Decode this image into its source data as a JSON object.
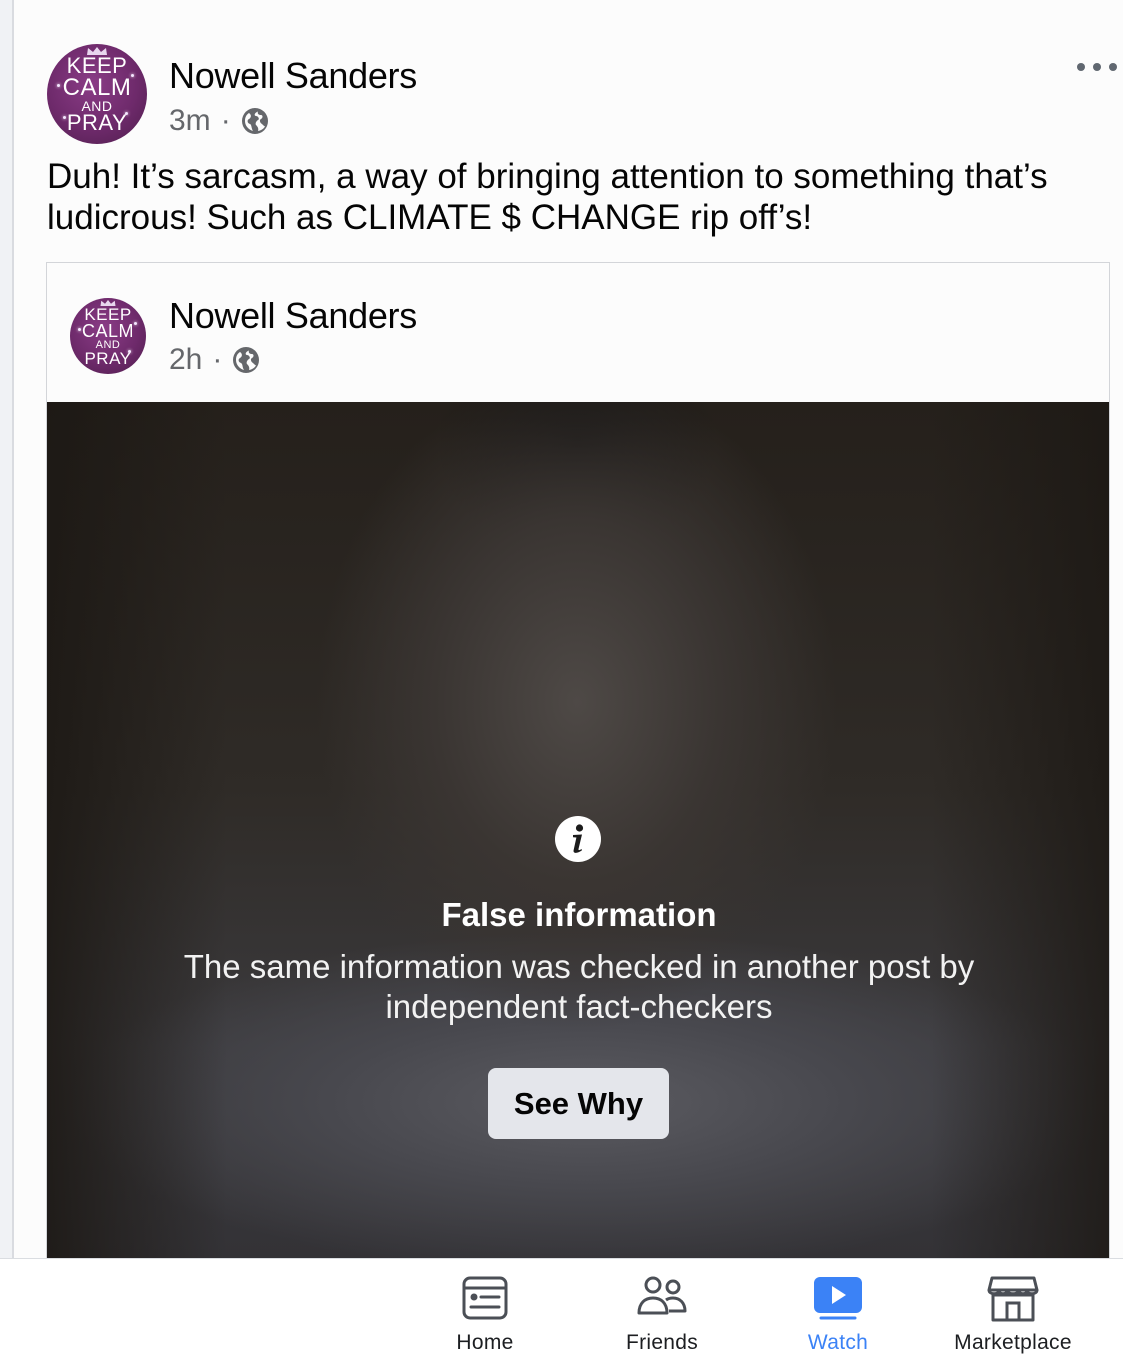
{
  "post": {
    "author": "Nowell Sanders",
    "time": "3m",
    "separator": "·",
    "text": "Duh! It’s sarcasm, a way of bringing attention to something that’s ludicrous! Such as CLIMATE $ CHANGE rip off’s!",
    "avatar_text": [
      "KEEP",
      "CALM",
      "AND",
      "PRAY"
    ]
  },
  "shared_post": {
    "author": "Nowell Sanders",
    "time": "2h",
    "separator": "·",
    "fact_check": {
      "title": "False information",
      "body": "The same information was checked in another post by independent fact-checkers",
      "button": "See Why"
    }
  },
  "tabbar": {
    "home": "Home",
    "friends": "Friends",
    "watch": "Watch",
    "marketplace": "Marketplace",
    "active": "watch"
  },
  "icons": {
    "privacy": "globe-icon",
    "more": "more-options-icon",
    "info": "info-icon"
  },
  "colors": {
    "accent": "#3b82f6",
    "meta_text": "#65676b",
    "avatar": "#6e2a6b",
    "button_bg": "#e4e6eb"
  }
}
